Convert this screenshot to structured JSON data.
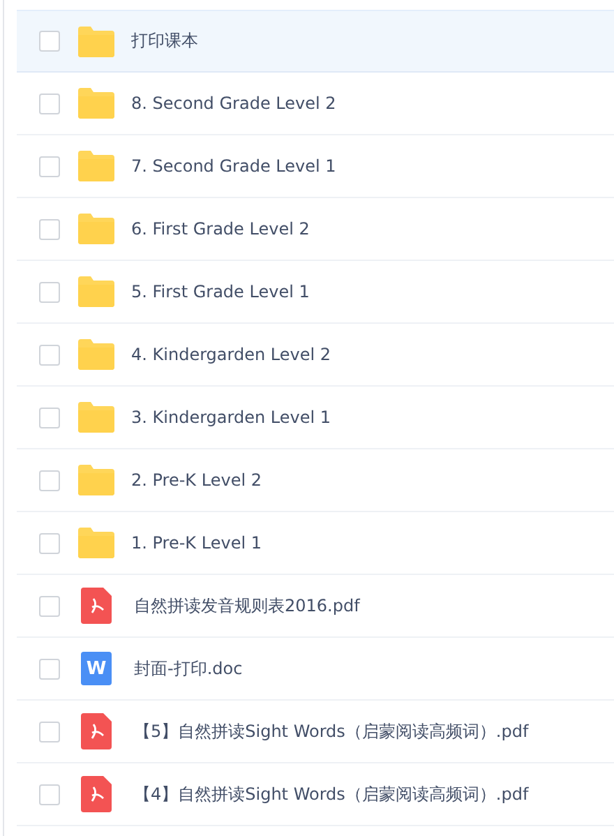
{
  "files": [
    {
      "kind": "folder",
      "name": "打印课本",
      "selected": true,
      "checked": false
    },
    {
      "kind": "folder",
      "name": "8. Second Grade Level 2",
      "selected": false,
      "checked": false
    },
    {
      "kind": "folder",
      "name": "7. Second Grade Level 1",
      "selected": false,
      "checked": false
    },
    {
      "kind": "folder",
      "name": "6. First Grade Level 2",
      "selected": false,
      "checked": false
    },
    {
      "kind": "folder",
      "name": "5. First Grade Level 1",
      "selected": false,
      "checked": false
    },
    {
      "kind": "folder",
      "name": "4. Kindergarden Level 2",
      "selected": false,
      "checked": false
    },
    {
      "kind": "folder",
      "name": "3. Kindergarden Level 1",
      "selected": false,
      "checked": false
    },
    {
      "kind": "folder",
      "name": "2. Pre-K Level 2",
      "selected": false,
      "checked": false
    },
    {
      "kind": "folder",
      "name": "1. Pre-K Level 1",
      "selected": false,
      "checked": false
    },
    {
      "kind": "pdf",
      "name": "自然拼读发音规则表2016.pdf",
      "selected": false,
      "checked": false
    },
    {
      "kind": "doc",
      "name": "封面-打印.doc",
      "badge": "W",
      "selected": false,
      "checked": false
    },
    {
      "kind": "pdf",
      "name": "【5】自然拼读Sight Words（启蒙阅读高频词）.pdf",
      "selected": false,
      "checked": false
    },
    {
      "kind": "pdf",
      "name": "【4】自然拼读Sight Words（启蒙阅读高频词）.pdf",
      "selected": false,
      "checked": false
    }
  ]
}
